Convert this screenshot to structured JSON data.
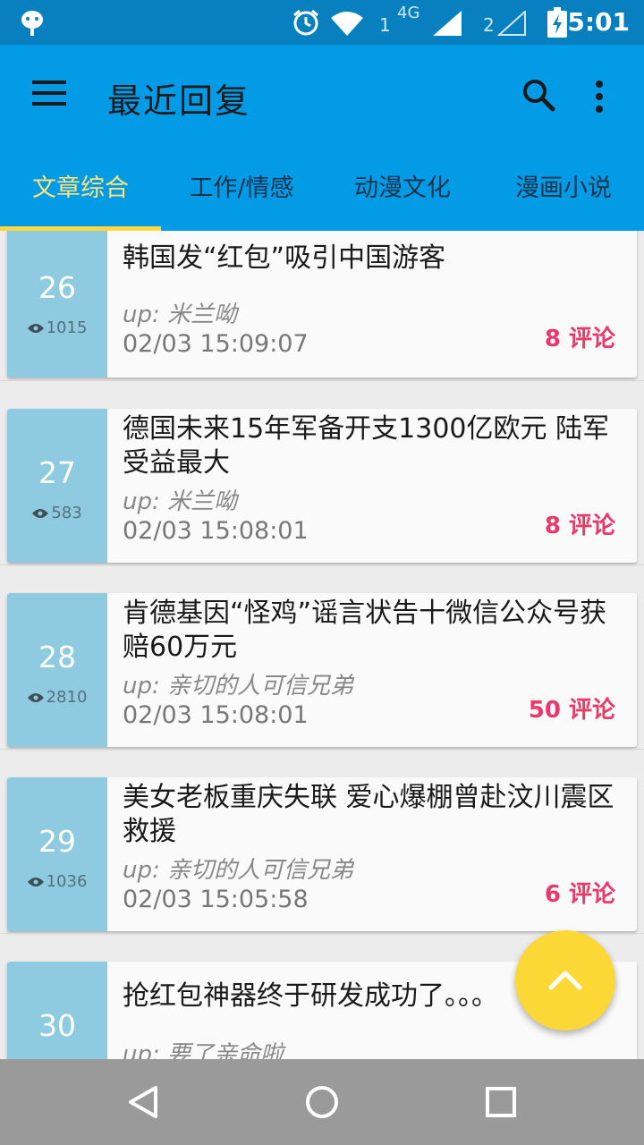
{
  "status_bar": {
    "time": "5:01",
    "sim1": "1",
    "net": "4G",
    "sim2": "2"
  },
  "appbar": {
    "title": "最近回复"
  },
  "tabs": [
    {
      "label": "文章综合",
      "active": true
    },
    {
      "label": "工作/情感",
      "active": false
    },
    {
      "label": "动漫文化",
      "active": false
    },
    {
      "label": "漫画小说",
      "active": false
    }
  ],
  "articles": [
    {
      "rank": "26",
      "views": "1015",
      "title": "韩国发“红包”吸引中国游客",
      "author": "up: 米兰呦",
      "date": "02/03 15:09:07",
      "comments": "8 评论"
    },
    {
      "rank": "27",
      "views": "583",
      "title": "德国未来15年军备开支1300亿欧元 陆军受益最大",
      "author": "up: 米兰呦",
      "date": "02/03 15:08:01",
      "comments": "8 评论"
    },
    {
      "rank": "28",
      "views": "2810",
      "title": "肯德基因“怪鸡”谣言状告十微信公众号获赔60万元",
      "author": "up: 亲切的人可信兄弟",
      "date": "02/03 15:08:01",
      "comments": "50 评论"
    },
    {
      "rank": "29",
      "views": "1036",
      "title": "美女老板重庆失联 爱心爆棚曾赴汶川震区救援",
      "author": "up: 亲切的人可信兄弟",
      "date": "02/03 15:05:58",
      "comments": "6 评论"
    },
    {
      "rank": "30",
      "title": "抢红包神器终于研发成功了。。。",
      "author": "up: 要了亲命啦"
    }
  ]
}
